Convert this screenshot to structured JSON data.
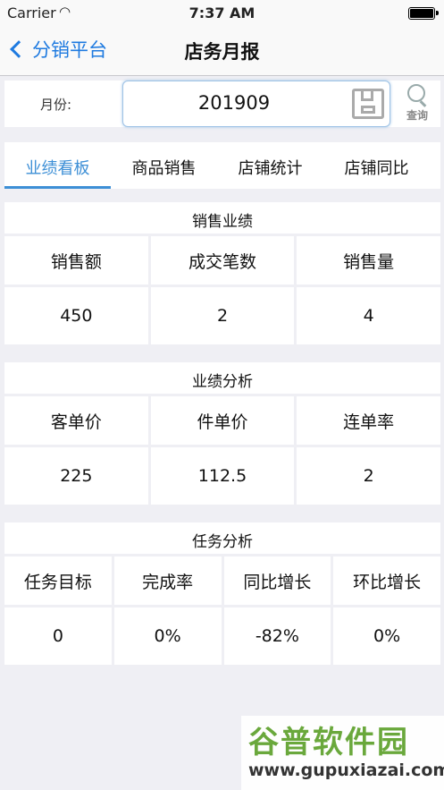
{
  "status": {
    "carrier": "Carrier",
    "time": "7:37 AM"
  },
  "nav": {
    "back_label": "分销平台",
    "title": "店务月报"
  },
  "month": {
    "label": "月份:",
    "value": "201909",
    "search_label": "查询"
  },
  "tabs": [
    "业绩看板",
    "商品销售",
    "店铺统计",
    "店铺同比"
  ],
  "sales": {
    "title": "销售业绩",
    "headers": [
      "销售额",
      "成交笔数",
      "销售量"
    ],
    "values": [
      "450",
      "2",
      "4"
    ]
  },
  "analysis": {
    "title": "业绩分析",
    "headers": [
      "客单价",
      "件单价",
      "连单率"
    ],
    "values": [
      "225",
      "112.5",
      "2"
    ]
  },
  "tasks": {
    "title": "任务分析",
    "headers": [
      "任务目标",
      "完成率",
      "同比增长",
      "环比增长"
    ],
    "values": [
      "0",
      "0%",
      "-82%",
      "0%"
    ]
  },
  "watermark": {
    "line1": "谷普软件园",
    "line2": "www.gupuxiazai.com"
  },
  "colors": {
    "accent": "#3d8fd6",
    "nav_link": "#1e7ae0",
    "background": "#efeff4"
  }
}
